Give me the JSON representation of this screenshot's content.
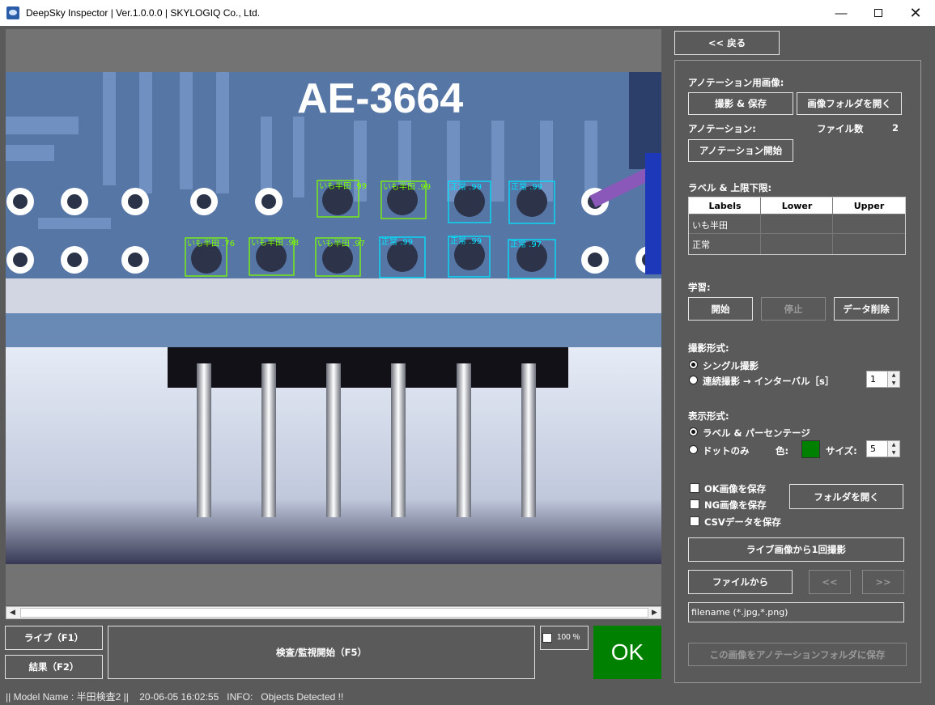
{
  "window": {
    "title": "DeepSky Inspector | Ver.1.0.0.0 | SKYLOGIQ Co., Ltd."
  },
  "viewer": {
    "pcb_label": "AE-3664",
    "detections": [
      {
        "label": "いも半田 .99",
        "kind": "imo"
      },
      {
        "label": "いも半田 .99",
        "kind": "imo"
      },
      {
        "label": "正常 .99",
        "kind": "ok"
      },
      {
        "label": "正常 .99",
        "kind": "ok"
      },
      {
        "label": "いも半田 .76",
        "kind": "imo"
      },
      {
        "label": "いも半田 .98",
        "kind": "imo"
      },
      {
        "label": "いも半田 .97",
        "kind": "imo"
      },
      {
        "label": "正常 .99",
        "kind": "ok"
      },
      {
        "label": "正常 .99",
        "kind": "ok"
      },
      {
        "label": "正常 .97",
        "kind": "ok"
      }
    ]
  },
  "controls": {
    "live_label": "ライブ（F1）",
    "result_label": "結果（F2）",
    "inspect_label": "検査/監視開始（F5）",
    "zoom_pct": "100 %",
    "judgement": "OK"
  },
  "status": {
    "model": "|| Model Name : 半田検査2 ||",
    "time": "20-06-05 16:02:55",
    "info": "INFO:   Objects Detected !!"
  },
  "panel": {
    "back_label": "<< 戻る",
    "annotation_images_heading": "アノテーション用画像:",
    "capture_save_label": "撮影 & 保存",
    "open_image_folder_label": "画像フォルダを開く",
    "annotation_heading": "アノテーション:",
    "file_count_label": "ファイル数",
    "file_count_value": "2",
    "annotation_start_label": "アノテーション開始",
    "label_limits_heading": "ラベル & 上限下限:",
    "table": {
      "headers": [
        "Labels",
        "Lower",
        "Upper"
      ],
      "rows": [
        [
          "いも半田",
          "",
          ""
        ],
        [
          "正常",
          "",
          ""
        ]
      ]
    },
    "learning_heading": "学習:",
    "start_label": "開始",
    "stop_label": "停止",
    "delete_data_label": "データ削除",
    "capture_mode_heading": "撮影形式:",
    "single_capture_label": "シングル撮影",
    "continuous_capture_label": "連続撮影 → インターバル［s］",
    "interval_value": "1",
    "display_mode_heading": "表示形式:",
    "label_percent_label": "ラベル & パーセンテージ",
    "dot_only_label": "ドットのみ",
    "color_label": "色:",
    "dot_color": "#008000",
    "size_label": "サイズ:",
    "size_value": "5",
    "save_ok_label": "OK画像を保存",
    "save_ng_label": "NG画像を保存",
    "save_csv_label": "CSVデータを保存",
    "open_folder_label": "フォルダを開く",
    "capture_once_label": "ライブ画像から1回撮影",
    "from_file_label": "ファイルから",
    "prev_label": "<<",
    "next_label": ">>",
    "filename_placeholder": "filename (*.jpg,*.png)",
    "save_to_annotation_label": "この画像をアノテーションフォルダに保存"
  }
}
